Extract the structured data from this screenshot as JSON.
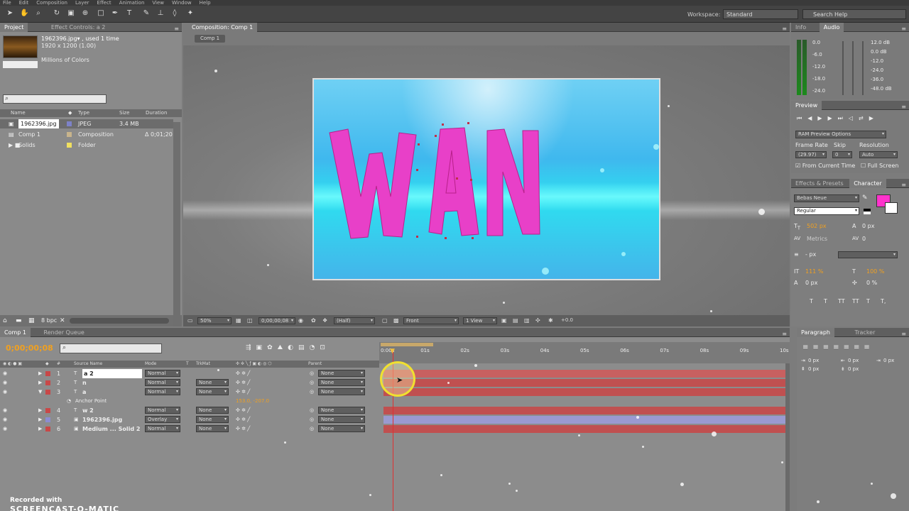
{
  "app": {
    "menus": [
      "File",
      "Edit",
      "Composition",
      "Layer",
      "Effect",
      "Animation",
      "View",
      "Window",
      "Help"
    ]
  },
  "toolbar": {
    "tools": [
      "selection-tool",
      "hand-tool",
      "zoom-tool",
      "rotate-tool",
      "camera-tool",
      "pan-behind-tool",
      "rectangle-tool",
      "pen-tool",
      "type-tool",
      "brush-tool",
      "clone-stamp-tool",
      "eraser-tool",
      "puppet-tool"
    ],
    "workspace_label": "Workspace:",
    "workspace_value": "Standard",
    "search_placeholder": "Search Help"
  },
  "project": {
    "tabs": [
      "Project",
      "Effect Controls: a 2"
    ],
    "info_name": "1962396.jpg▾ , used 1 time",
    "info_dims": "1920 x 1200 (1.00)",
    "info_colors": "Millions of Colors",
    "columns": [
      "Name",
      "Type",
      "Size",
      "Duration"
    ],
    "items": [
      {
        "name": "1962396.jpg",
        "type": "JPEG",
        "size": "3.4 MB",
        "duration": "",
        "color": "#7d82c8"
      },
      {
        "name": "Comp 1",
        "type": "Composition",
        "size": "",
        "duration": "Δ 0;01;20",
        "color": "#c8b48c"
      },
      {
        "name": "Solids",
        "type": "Folder",
        "size": "",
        "duration": "",
        "color": "#f0e060"
      }
    ],
    "bpc": "8 bpc"
  },
  "composition": {
    "tab": "Composition: Comp 1",
    "subtab": "Comp 1",
    "title_text": "WAN",
    "footer": {
      "zoom": "50%",
      "timecode": "0;00;00;08",
      "resolution": "(Half)",
      "view": "Front",
      "views": "1 View",
      "exposure": "+0.0"
    }
  },
  "info_audio": {
    "tabs": [
      "Info",
      "Audio"
    ],
    "left_scale": [
      "0.0",
      "-6.0",
      "-12.0",
      "-18.0",
      "-24.0"
    ],
    "right_scale": [
      "12.0 dB",
      "0.0 dB",
      "-12.0",
      "-24.0",
      "-36.0",
      "-48.0 dB"
    ]
  },
  "preview": {
    "title": "Preview",
    "ram_options": "RAM Preview Options",
    "frame_rate_label": "Frame Rate",
    "skip_label": "Skip",
    "resolution_label": "Resolution",
    "frame_rate": "(29.97)",
    "skip": "0",
    "resolution": "Auto",
    "from_current": "From Current Time",
    "full_screen": "Full Screen"
  },
  "character": {
    "tabs": [
      "Effects & Presets",
      "Character"
    ],
    "font": "Bebas Neue",
    "style": "Regular",
    "size": "502 px",
    "leading": "0 px",
    "kerning": "Metrics",
    "tracking": "0",
    "stroke": "- px",
    "vscale": "111 %",
    "hscale": "100 %",
    "baseline": "0 px",
    "tsume": "0 %",
    "fill_color": "#ff33cc",
    "styles": [
      "T",
      "T",
      "TT",
      "TT",
      "T",
      "T,"
    ]
  },
  "timeline": {
    "tabs": [
      "Comp 1",
      "Render Queue"
    ],
    "timecode": "0;00;00;08",
    "columns": [
      "#",
      "Source Name",
      "Mode",
      "T",
      "TrkMat",
      "Parent"
    ],
    "ruler": [
      "0:00s",
      "01s",
      "02s",
      "03s",
      "04s",
      "05s",
      "06s",
      "07s",
      "08s",
      "09s",
      "10s"
    ],
    "layers": [
      {
        "num": "1",
        "name": "a 2",
        "mode": "Normal",
        "trkmat": "",
        "parent": "None",
        "color": "#c84848",
        "type": "T",
        "track": "#c86060"
      },
      {
        "num": "2",
        "name": "n",
        "mode": "Normal",
        "trkmat": "None",
        "parent": "None",
        "color": "#c84848",
        "type": "T",
        "track": "#c05050"
      },
      {
        "num": "3",
        "name": "a",
        "mode": "Normal",
        "trkmat": "None",
        "parent": "None",
        "color": "#c84848",
        "type": "T",
        "track": "#c05050"
      },
      {
        "num": "4",
        "name": "w 2",
        "mode": "Normal",
        "trkmat": "None",
        "parent": "None",
        "color": "#c84848",
        "type": "T",
        "track": "#c05050"
      },
      {
        "num": "5",
        "name": "1962396.jpg",
        "mode": "Overlay",
        "trkmat": "None",
        "parent": "None",
        "color": "#8c8cd2",
        "type": "img",
        "track": "#9a9ad0"
      },
      {
        "num": "6",
        "name": "Medium ... Solid 2",
        "mode": "Normal",
        "trkmat": "None",
        "parent": "None",
        "color": "#c84848",
        "type": "solid",
        "track": "#c05050"
      }
    ],
    "anchor_label": "Anchor Point",
    "anchor_value": "153.0, -207.0"
  },
  "paragraph": {
    "tabs": [
      "Paragraph",
      "Tracker"
    ],
    "values": [
      "0 px",
      "0 px",
      "0 px",
      "0 px",
      "0 px"
    ]
  },
  "watermark": {
    "line1": "Recorded with",
    "line2": "SCREENCAST-O-MATIC"
  },
  "colors": {
    "letters": "#e840c8",
    "comp_bg": "#34b8f0",
    "accent": "#f0a020"
  }
}
